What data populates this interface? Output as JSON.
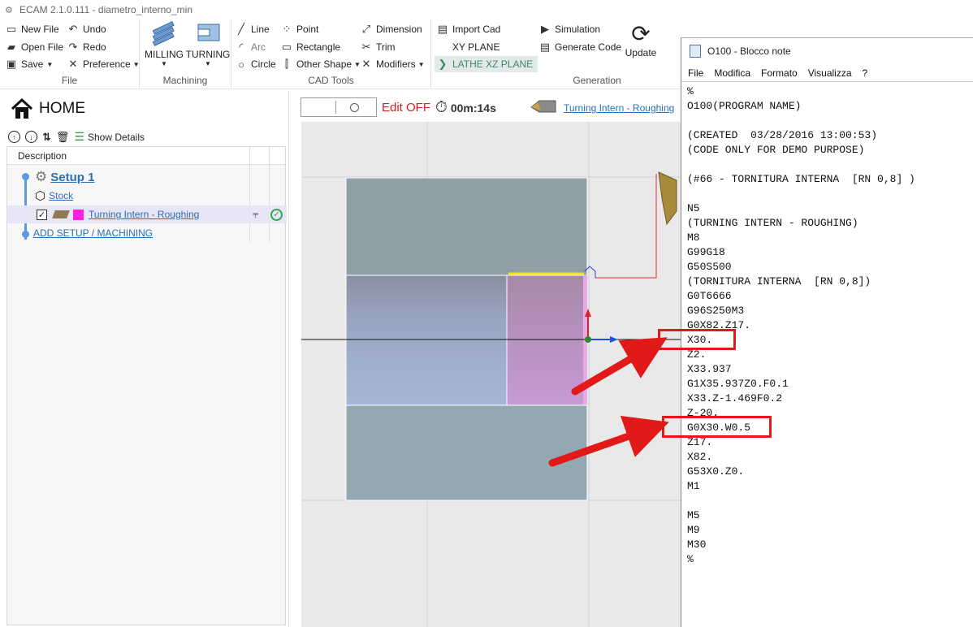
{
  "window": {
    "title": "ECAM 2.1.0.111 - diametro_interno_min"
  },
  "ribbon": {
    "file": {
      "label": "File",
      "new_file": "New File",
      "open_file": "Open File",
      "save": "Save",
      "undo": "Undo",
      "redo": "Redo",
      "preference": "Preference"
    },
    "machining": {
      "label": "Machining",
      "milling": "MILLING",
      "turning": "TURNING"
    },
    "cad": {
      "label": "CAD Tools",
      "line": "Line",
      "arc": "Arc",
      "circle": "Circle",
      "point": "Point",
      "rectangle": "Rectangle",
      "other_shape": "Other Shape",
      "dimension": "Dimension",
      "trim": "Trim",
      "modifiers": "Modifiers"
    },
    "plane": {
      "import_cad": "Import Cad",
      "xy_plane": "XY PLANE",
      "lathe_xz_plane": "LATHE XZ PLANE"
    },
    "generation": {
      "label": "Generation",
      "simulation": "Simulation",
      "generate_code": "Generate Code",
      "update": "Update"
    }
  },
  "left": {
    "home": "HOME",
    "show_details": "Show Details",
    "tree_header": "Description",
    "setup": "Setup 1",
    "stock": "Stock",
    "operation": "Turning Intern - Roughing",
    "add_setup": "ADD SETUP / MACHINING"
  },
  "canvas": {
    "edit_state": "Edit OFF",
    "time": "00m:14s",
    "operation": "Turning Intern - Roughing"
  },
  "notepad": {
    "title": "O100 - Blocco note",
    "menu": [
      "File",
      "Modifica",
      "Formato",
      "Visualizza",
      "?"
    ],
    "lines": [
      "%",
      "O100(PROGRAM NAME)",
      "",
      "(CREATED  03/28/2016 13:00:53)",
      "(CODE ONLY FOR DEMO PURPOSE)",
      "",
      "(#66 - TORNITURA INTERNA  [RN 0,8] )",
      "",
      "N5",
      "(TURNING INTERN - ROUGHING)",
      "M8",
      "G99G18",
      "G50S500",
      "(TORNITURA INTERNA  [RN 0,8])",
      "G0T6666",
      "G96S250M3",
      "G0X82.Z17.",
      "X30.",
      "Z2.",
      "X33.937",
      "G1X35.937Z0.F0.1",
      "X33.Z-1.469F0.2",
      "Z-20.",
      "G0X30.W0.5",
      "Z17.",
      "X82.",
      "G53X0.Z0.",
      "M1",
      "",
      "M5",
      "M9",
      "M30",
      "%"
    ]
  },
  "colors": {
    "accent_link": "#2b6fb5",
    "edit_off": "#d61f1f",
    "highlight_box": "#e11919",
    "selected_plane": "#3a8a5c"
  }
}
